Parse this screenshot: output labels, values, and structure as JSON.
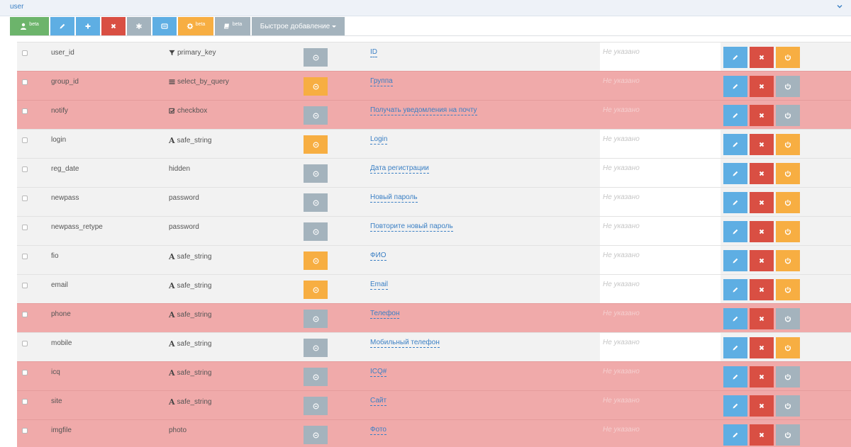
{
  "panel": {
    "title": "user"
  },
  "toolbar": {
    "buttons": [
      {
        "id": "user",
        "badge": "beta",
        "color": "#6cb46b",
        "icon": "user-icon"
      },
      {
        "id": "edit",
        "badge": "",
        "color": "#5eaee3",
        "icon": "pencil-icon"
      },
      {
        "id": "add",
        "badge": "",
        "color": "#5eaee3",
        "icon": "plus-icon"
      },
      {
        "id": "delete",
        "badge": "",
        "color": "#d94f43",
        "icon": "close-icon"
      },
      {
        "id": "asterisk",
        "badge": "",
        "color": "#a4b3bd",
        "icon": "asterisk-icon"
      },
      {
        "id": "list",
        "badge": "",
        "color": "#5eaee3",
        "icon": "list-icon"
      },
      {
        "id": "settings",
        "badge": "beta",
        "color": "#f7ae42",
        "icon": "gear-icon"
      },
      {
        "id": "book",
        "badge": "beta",
        "color": "#a4b3bd",
        "icon": "book-icon"
      }
    ],
    "quick_add_label": "Быстрое добавление"
  },
  "colors": {
    "gray_button": "#a4b3bd",
    "orange_button": "#f7ae42",
    "red_row": "#f0aaaa"
  },
  "default_text": "Не указано",
  "rows": [
    {
      "name": "user_id",
      "type": "primary_key",
      "type_icon": "filter-icon",
      "label": "ID",
      "red": false,
      "toggle": "gray",
      "power": "orange"
    },
    {
      "name": "group_id",
      "type": "select_by_query",
      "type_icon": "list-icon",
      "label": "Группа",
      "red": true,
      "toggle": "orange",
      "power": "gray"
    },
    {
      "name": "notify",
      "type": "checkbox",
      "type_icon": "checkbox-icon",
      "label": "Получать уведомления на почту",
      "red": true,
      "toggle": "gray",
      "power": "gray"
    },
    {
      "name": "login",
      "type": "safe_string",
      "type_icon": "font-icon",
      "label": "Login",
      "red": false,
      "toggle": "orange",
      "power": "orange"
    },
    {
      "name": "reg_date",
      "type": "hidden",
      "type_icon": "",
      "label": "Дата регистрации",
      "red": false,
      "toggle": "gray",
      "power": "orange"
    },
    {
      "name": "newpass",
      "type": "password",
      "type_icon": "",
      "label": "Новый пароль",
      "red": false,
      "toggle": "gray",
      "power": "orange"
    },
    {
      "name": "newpass_retype",
      "type": "password",
      "type_icon": "",
      "label": "Повторите новый пароль",
      "red": false,
      "toggle": "gray",
      "power": "orange"
    },
    {
      "name": "fio",
      "type": "safe_string",
      "type_icon": "font-icon",
      "label": "ФИО",
      "red": false,
      "toggle": "orange",
      "power": "orange"
    },
    {
      "name": "email",
      "type": "safe_string",
      "type_icon": "font-icon",
      "label": "Email",
      "red": false,
      "toggle": "orange",
      "power": "orange"
    },
    {
      "name": "phone",
      "type": "safe_string",
      "type_icon": "font-icon",
      "label": "Телефон",
      "red": true,
      "toggle": "gray",
      "power": "gray"
    },
    {
      "name": "mobile",
      "type": "safe_string",
      "type_icon": "font-icon",
      "label": "Мобильный телефон",
      "red": false,
      "toggle": "gray",
      "power": "orange"
    },
    {
      "name": "icq",
      "type": "safe_string",
      "type_icon": "font-icon",
      "label": "ICQ#",
      "red": true,
      "toggle": "gray",
      "power": "gray"
    },
    {
      "name": "site",
      "type": "safe_string",
      "type_icon": "font-icon",
      "label": "Сайт",
      "red": true,
      "toggle": "gray",
      "power": "gray"
    },
    {
      "name": "imgfile",
      "type": "photo",
      "type_icon": "",
      "label": "Фото",
      "red": true,
      "toggle": "gray",
      "power": "gray"
    }
  ]
}
